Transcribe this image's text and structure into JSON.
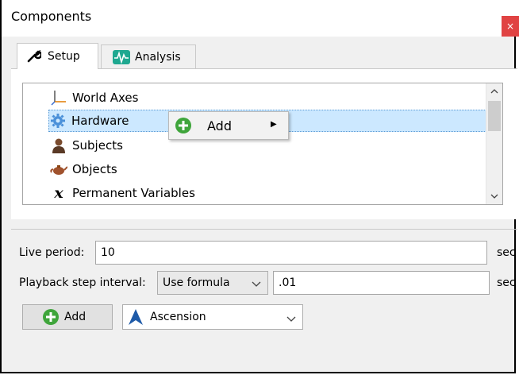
{
  "window": {
    "title": "Components",
    "close_glyph": "×"
  },
  "tabs": [
    {
      "label": "Setup",
      "icon": "wrench-icon",
      "active": true
    },
    {
      "label": "Analysis",
      "icon": "waveform-icon",
      "active": false
    }
  ],
  "tree": {
    "items": [
      {
        "label": "World Axes",
        "icon": "axes-icon"
      },
      {
        "label": "Hardware",
        "icon": "gear-icon",
        "selected": true
      },
      {
        "label": "Subjects",
        "icon": "person-icon"
      },
      {
        "label": "Objects",
        "icon": "teapot-icon"
      },
      {
        "label": "Permanent Variables",
        "icon": "variable-x-icon"
      }
    ]
  },
  "context_menu": {
    "items": [
      {
        "label": "Add",
        "icon": "plus-circle-icon",
        "submenu": true
      }
    ]
  },
  "live_period": {
    "label": "Live period:",
    "value": "10",
    "unit": "sec"
  },
  "playback": {
    "label": "Playback step interval:",
    "mode": "Use formula",
    "value": ".01",
    "unit": "sec"
  },
  "toolbar": {
    "add_label": "Add",
    "device": "Ascension"
  },
  "colors": {
    "accent_green": "#3fa53b",
    "selection": "#cce8ff",
    "close_red": "#e04343"
  }
}
